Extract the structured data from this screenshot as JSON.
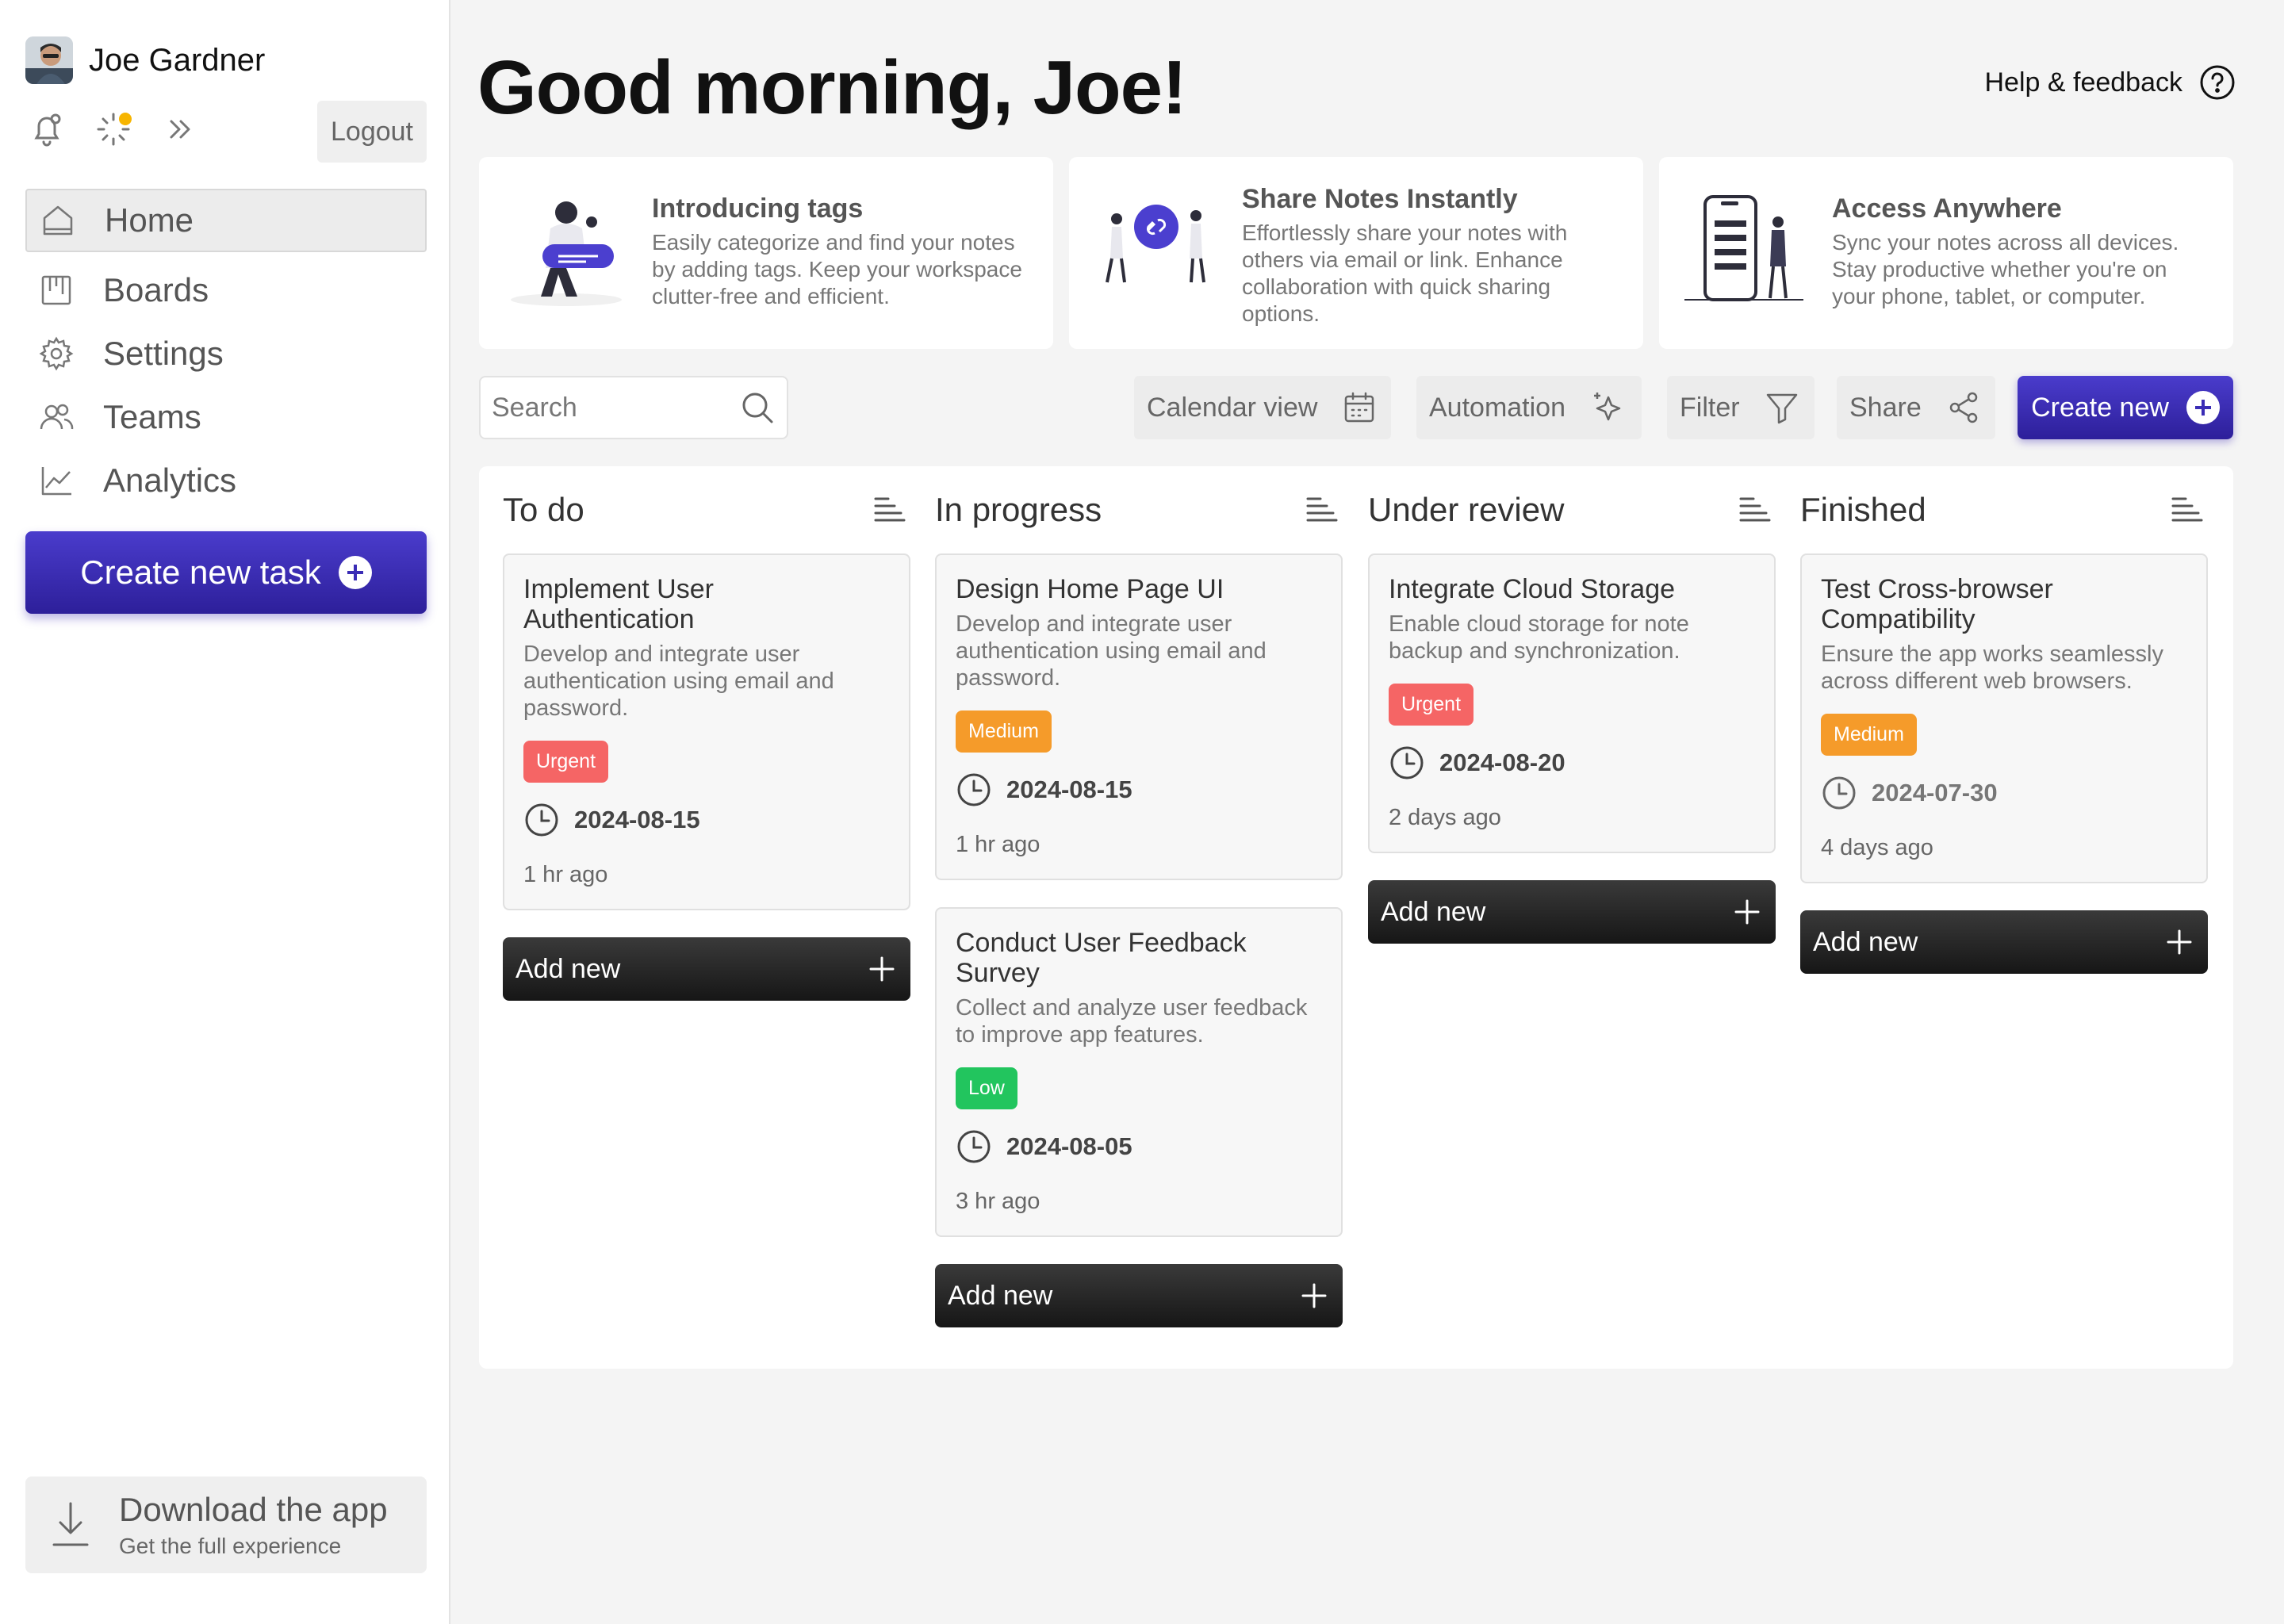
{
  "user": {
    "name": "Joe Gardner",
    "logout_label": "Logout"
  },
  "sidebar": {
    "items": [
      {
        "label": "Home",
        "icon": "home-icon",
        "active": true
      },
      {
        "label": "Boards",
        "icon": "boards-icon"
      },
      {
        "label": "Settings",
        "icon": "gear-icon"
      },
      {
        "label": "Teams",
        "icon": "teams-icon"
      },
      {
        "label": "Analytics",
        "icon": "analytics-icon"
      }
    ],
    "create_task_label": "Create new task",
    "download": {
      "title": "Download the app",
      "subtitle": "Get the full experience"
    }
  },
  "header": {
    "greeting": "Good morning, Joe!",
    "help_label": "Help & feedback"
  },
  "promos": [
    {
      "title": "Introducing tags",
      "text": "Easily categorize and find your notes by adding tags. Keep your workspace clutter-free and efficient."
    },
    {
      "title": "Share Notes Instantly",
      "text": "Effortlessly share your notes with others via email or link. Enhance collaboration with quick sharing options."
    },
    {
      "title": "Access Anywhere",
      "text": "Sync your notes across all devices. Stay productive whether you're on your phone, tablet, or computer."
    }
  ],
  "toolbar": {
    "search_placeholder": "Search",
    "calendar_label": "Calendar view",
    "automation_label": "Automation",
    "filter_label": "Filter",
    "share_label": "Share",
    "create_label": "Create new"
  },
  "colors": {
    "accent": "#3a2cb5",
    "urgent": "#f56565",
    "medium": "#f59b2a",
    "low": "#22c55e",
    "dark_button": "#1e1e1e"
  },
  "board": {
    "add_label": "Add new",
    "columns": [
      {
        "title": "To do",
        "cards": [
          {
            "title": "Implement User Authentication",
            "desc": "Develop and integrate user authentication using email and password.",
            "tag": "Urgent",
            "date": "2024-08-15",
            "ago": "1 hr ago"
          }
        ]
      },
      {
        "title": "In progress",
        "cards": [
          {
            "title": "Design Home Page UI",
            "desc": "Develop and integrate user authentication using email and password.",
            "tag": "Medium",
            "date": "2024-08-15",
            "ago": "1 hr ago"
          },
          {
            "title": "Conduct User Feedback Survey",
            "desc": "Collect and analyze user feedback to improve app features.",
            "tag": "Low",
            "date": "2024-08-05",
            "ago": "3 hr ago"
          }
        ]
      },
      {
        "title": "Under review",
        "cards": [
          {
            "title": "Integrate Cloud Storage",
            "desc": "Enable cloud storage for note backup and synchronization.",
            "tag": "Urgent",
            "date": "2024-08-20",
            "ago": "2 days  ago"
          }
        ]
      },
      {
        "title": "Finished",
        "cards": [
          {
            "title": "Test Cross-browser Compatibility",
            "desc": "Ensure the app works seamlessly across different web browsers.",
            "tag": "Medium",
            "date": "2024-07-30",
            "ago": "4 days ago"
          }
        ]
      }
    ]
  }
}
